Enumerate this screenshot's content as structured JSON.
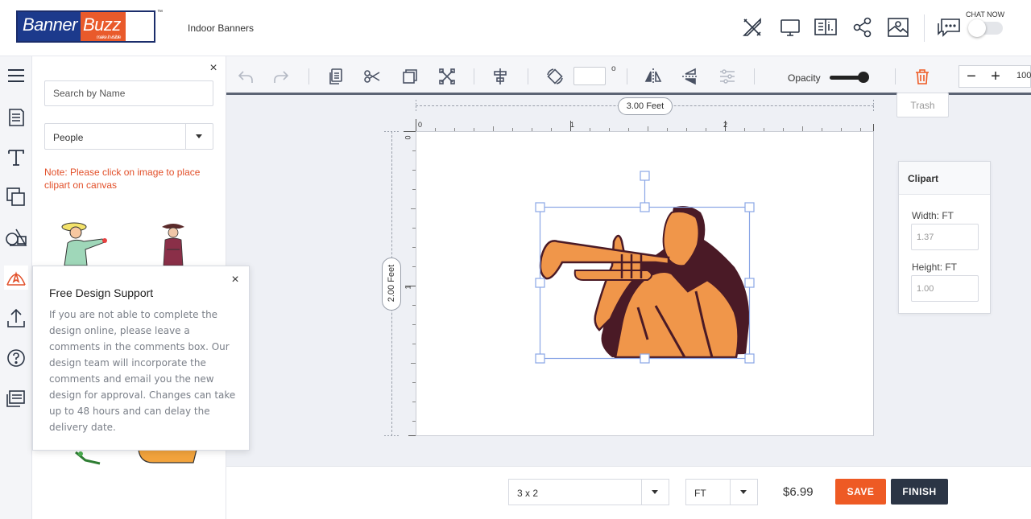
{
  "brand": {
    "name_a": "Banner",
    "name_b": "Buzz",
    "tagline": "make it visible",
    "tm": "™"
  },
  "breadcrumb": "Indoor Banners",
  "header": {
    "chat_label": "CHAT NOW"
  },
  "panel": {
    "search_placeholder": "Search by Name",
    "category": "People",
    "note": "Note: Please click on image to place clipart on canvas",
    "close": "×"
  },
  "support": {
    "title": "Free Design Support",
    "text": "If you are not able to complete the design online, please leave a comments in the comments box. Our design team will incorporate the comments and email you the new design for approval. Changes can take up to 48 hours and can delay the delivery date.",
    "close": "×"
  },
  "toolbar": {
    "rotation_value": "",
    "degree": "o",
    "opacity_label": "Opacity",
    "opacity_value": 1.0,
    "zoom_minus": "−",
    "zoom_plus": "+",
    "zoom_value": "100",
    "trash_tooltip": "Trash"
  },
  "canvas": {
    "width_label": "3.00 Feet",
    "height_label": "2.00 Feet",
    "ruler_h": [
      "0",
      "1",
      "2"
    ],
    "ruler_v": [
      "0",
      "1"
    ]
  },
  "clipart_props": {
    "title": "Clipart",
    "width_label": "Width: FT",
    "width_value": "1.37",
    "height_label": "Height: FT",
    "height_value": "1.00"
  },
  "footer": {
    "size": "3 x 2",
    "unit": "FT",
    "price": "$6.99",
    "save": "SAVE",
    "finish": "FINISH"
  },
  "colors": {
    "accent": "#ee5a24",
    "dark": "#2b3545",
    "brand_blue": "#1c3a8c",
    "selection": "#8aa6e6"
  }
}
